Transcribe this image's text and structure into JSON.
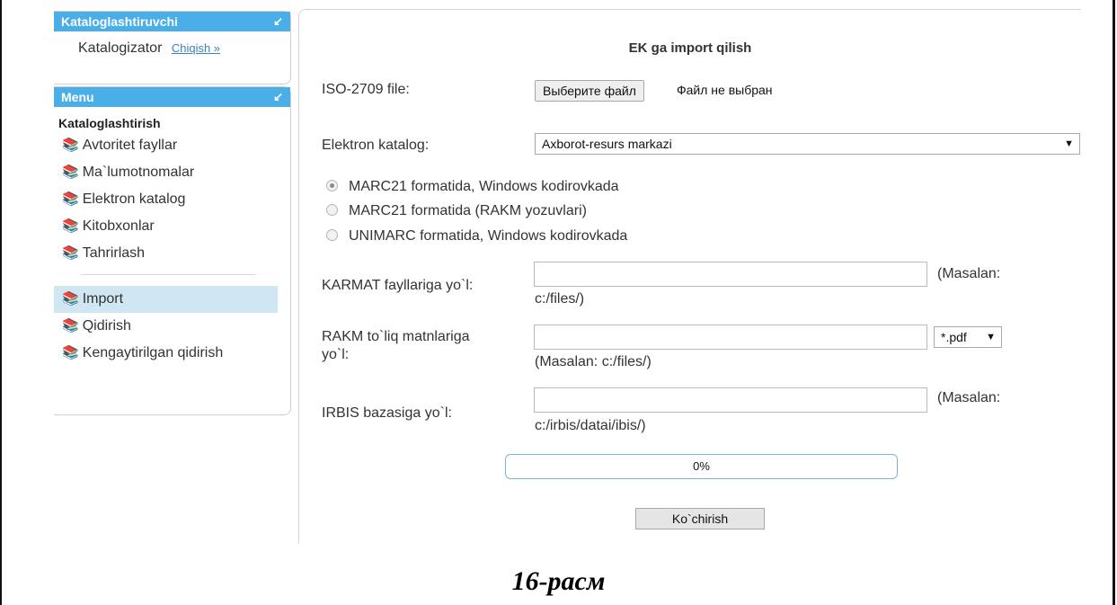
{
  "catalogger_panel": {
    "title": "Kataloglashtiruvchi",
    "user": "Katalogizator",
    "logout": "Chiqish »"
  },
  "menu": {
    "title": "Menu",
    "section": "Kataloglashtirish",
    "items": [
      {
        "label": "Avtoritet fayllar"
      },
      {
        "label": "Ma`lumotnomalar"
      },
      {
        "label": "Elektron katalog"
      },
      {
        "label": "Kitobxonlar"
      },
      {
        "label": "Tahrirlash"
      }
    ],
    "items2": [
      {
        "label": "Import",
        "active": true
      },
      {
        "label": "Qidirish"
      },
      {
        "label": "Kengaytirilgan qidirish"
      }
    ]
  },
  "form": {
    "title": "EK ga import qilish",
    "iso_label": "ISO-2709 file:",
    "file_button": "Выберите файл",
    "file_status": "Файл не выбран",
    "catalog_label": "Elektron katalog:",
    "catalog_value": "Axborot-resurs markazi",
    "radios": [
      {
        "label": "MARC21 formatida, Windows kodirovkada",
        "checked": true
      },
      {
        "label": "MARC21 formatida (RAKM yozuvlari)",
        "checked": false
      },
      {
        "label": "UNIMARC formatida, Windows kodirovkada",
        "checked": false
      }
    ],
    "karmat_label": "KARMAT fayllariga yo`l:",
    "karmat_value": "",
    "karmat_note_1": "(Masalan:",
    "karmat_note_2": "c:/files/)",
    "rakm_label_1": "RAKM to`liq matnlariga",
    "rakm_label_2": "yo`l:",
    "rakm_value": "",
    "rakm_ext": "*.pdf",
    "rakm_note": "(Masalan: c:/files/)",
    "irbis_label": "IRBIS bazasiga yo`l:",
    "irbis_value": "",
    "irbis_note_1": "(Masalan:",
    "irbis_note_2": "c:/irbis/datai/ibis/)",
    "progress_text": "0%",
    "progress": 0,
    "submit": "Ko`chirish"
  },
  "caption": "16-расм",
  "colors": {
    "accent": "#4aaee9",
    "active_item": "#d0e6f2",
    "progress_border": "#7ab3dc"
  }
}
